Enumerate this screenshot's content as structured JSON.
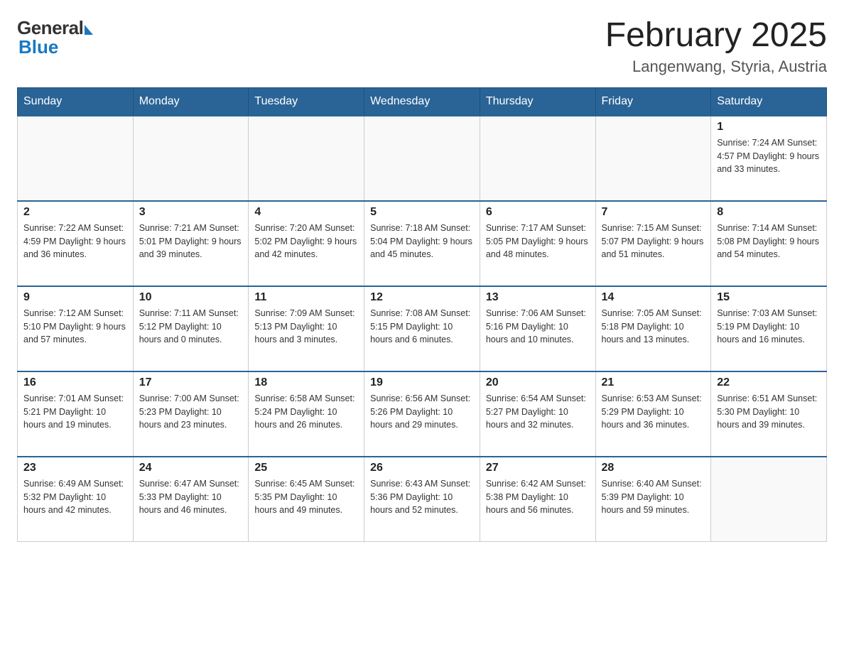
{
  "logo": {
    "general": "General",
    "blue": "Blue"
  },
  "header": {
    "month_year": "February 2025",
    "location": "Langenwang, Styria, Austria"
  },
  "days_of_week": [
    "Sunday",
    "Monday",
    "Tuesday",
    "Wednesday",
    "Thursday",
    "Friday",
    "Saturday"
  ],
  "weeks": [
    [
      {
        "day": "",
        "info": ""
      },
      {
        "day": "",
        "info": ""
      },
      {
        "day": "",
        "info": ""
      },
      {
        "day": "",
        "info": ""
      },
      {
        "day": "",
        "info": ""
      },
      {
        "day": "",
        "info": ""
      },
      {
        "day": "1",
        "info": "Sunrise: 7:24 AM\nSunset: 4:57 PM\nDaylight: 9 hours and 33 minutes."
      }
    ],
    [
      {
        "day": "2",
        "info": "Sunrise: 7:22 AM\nSunset: 4:59 PM\nDaylight: 9 hours and 36 minutes."
      },
      {
        "day": "3",
        "info": "Sunrise: 7:21 AM\nSunset: 5:01 PM\nDaylight: 9 hours and 39 minutes."
      },
      {
        "day": "4",
        "info": "Sunrise: 7:20 AM\nSunset: 5:02 PM\nDaylight: 9 hours and 42 minutes."
      },
      {
        "day": "5",
        "info": "Sunrise: 7:18 AM\nSunset: 5:04 PM\nDaylight: 9 hours and 45 minutes."
      },
      {
        "day": "6",
        "info": "Sunrise: 7:17 AM\nSunset: 5:05 PM\nDaylight: 9 hours and 48 minutes."
      },
      {
        "day": "7",
        "info": "Sunrise: 7:15 AM\nSunset: 5:07 PM\nDaylight: 9 hours and 51 minutes."
      },
      {
        "day": "8",
        "info": "Sunrise: 7:14 AM\nSunset: 5:08 PM\nDaylight: 9 hours and 54 minutes."
      }
    ],
    [
      {
        "day": "9",
        "info": "Sunrise: 7:12 AM\nSunset: 5:10 PM\nDaylight: 9 hours and 57 minutes."
      },
      {
        "day": "10",
        "info": "Sunrise: 7:11 AM\nSunset: 5:12 PM\nDaylight: 10 hours and 0 minutes."
      },
      {
        "day": "11",
        "info": "Sunrise: 7:09 AM\nSunset: 5:13 PM\nDaylight: 10 hours and 3 minutes."
      },
      {
        "day": "12",
        "info": "Sunrise: 7:08 AM\nSunset: 5:15 PM\nDaylight: 10 hours and 6 minutes."
      },
      {
        "day": "13",
        "info": "Sunrise: 7:06 AM\nSunset: 5:16 PM\nDaylight: 10 hours and 10 minutes."
      },
      {
        "day": "14",
        "info": "Sunrise: 7:05 AM\nSunset: 5:18 PM\nDaylight: 10 hours and 13 minutes."
      },
      {
        "day": "15",
        "info": "Sunrise: 7:03 AM\nSunset: 5:19 PM\nDaylight: 10 hours and 16 minutes."
      }
    ],
    [
      {
        "day": "16",
        "info": "Sunrise: 7:01 AM\nSunset: 5:21 PM\nDaylight: 10 hours and 19 minutes."
      },
      {
        "day": "17",
        "info": "Sunrise: 7:00 AM\nSunset: 5:23 PM\nDaylight: 10 hours and 23 minutes."
      },
      {
        "day": "18",
        "info": "Sunrise: 6:58 AM\nSunset: 5:24 PM\nDaylight: 10 hours and 26 minutes."
      },
      {
        "day": "19",
        "info": "Sunrise: 6:56 AM\nSunset: 5:26 PM\nDaylight: 10 hours and 29 minutes."
      },
      {
        "day": "20",
        "info": "Sunrise: 6:54 AM\nSunset: 5:27 PM\nDaylight: 10 hours and 32 minutes."
      },
      {
        "day": "21",
        "info": "Sunrise: 6:53 AM\nSunset: 5:29 PM\nDaylight: 10 hours and 36 minutes."
      },
      {
        "day": "22",
        "info": "Sunrise: 6:51 AM\nSunset: 5:30 PM\nDaylight: 10 hours and 39 minutes."
      }
    ],
    [
      {
        "day": "23",
        "info": "Sunrise: 6:49 AM\nSunset: 5:32 PM\nDaylight: 10 hours and 42 minutes."
      },
      {
        "day": "24",
        "info": "Sunrise: 6:47 AM\nSunset: 5:33 PM\nDaylight: 10 hours and 46 minutes."
      },
      {
        "day": "25",
        "info": "Sunrise: 6:45 AM\nSunset: 5:35 PM\nDaylight: 10 hours and 49 minutes."
      },
      {
        "day": "26",
        "info": "Sunrise: 6:43 AM\nSunset: 5:36 PM\nDaylight: 10 hours and 52 minutes."
      },
      {
        "day": "27",
        "info": "Sunrise: 6:42 AM\nSunset: 5:38 PM\nDaylight: 10 hours and 56 minutes."
      },
      {
        "day": "28",
        "info": "Sunrise: 6:40 AM\nSunset: 5:39 PM\nDaylight: 10 hours and 59 minutes."
      },
      {
        "day": "",
        "info": ""
      }
    ]
  ]
}
